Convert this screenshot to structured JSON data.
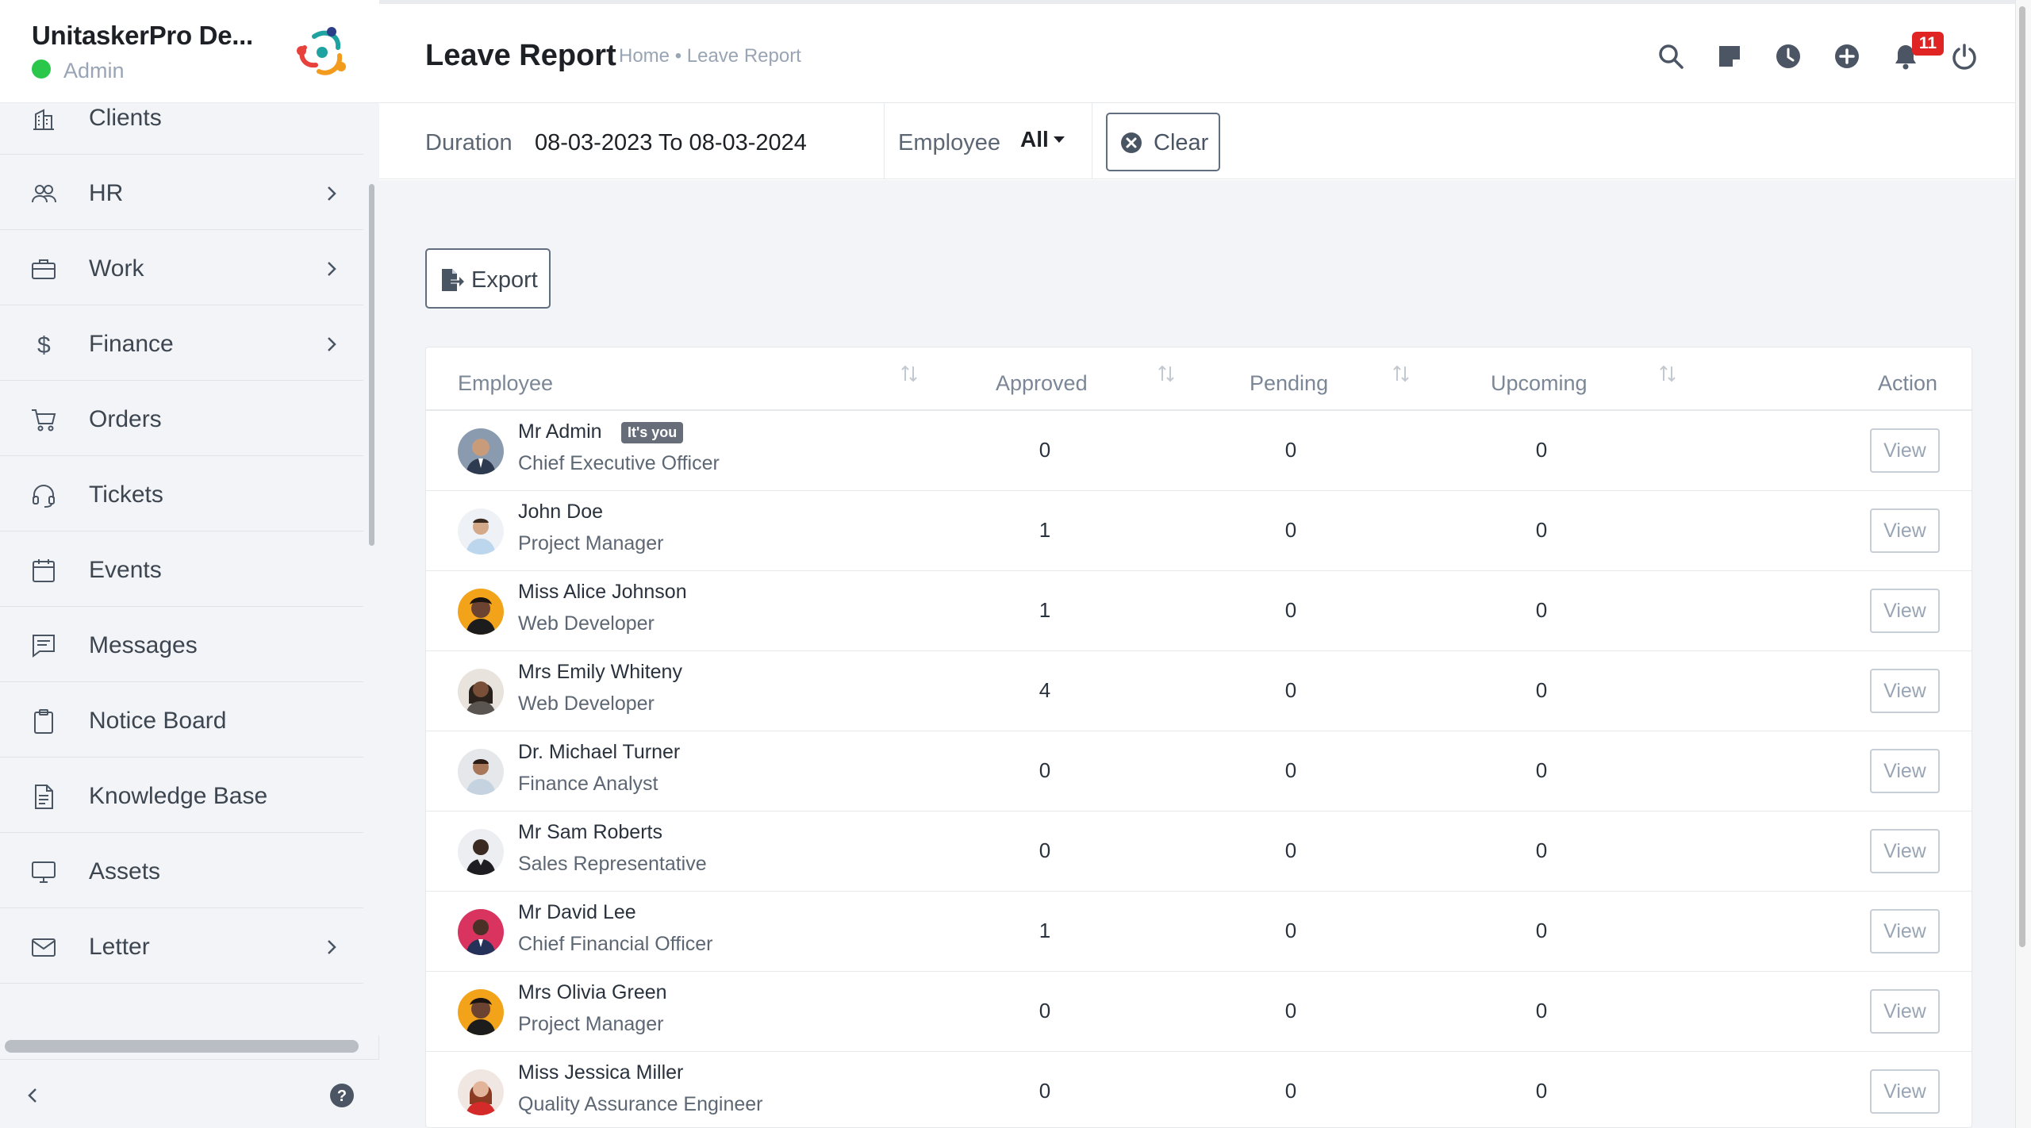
{
  "sidebar": {
    "company_name": "UnitaskerPro De...",
    "user_role": "Admin",
    "online_color": "#2bc74b",
    "items": [
      {
        "label": "Clients",
        "icon": "building-icon",
        "has_chevron": false
      },
      {
        "label": "HR",
        "icon": "users-icon",
        "has_chevron": true
      },
      {
        "label": "Work",
        "icon": "briefcase-icon",
        "has_chevron": true
      },
      {
        "label": "Finance",
        "icon": "dollar-icon",
        "has_chevron": true
      },
      {
        "label": "Orders",
        "icon": "cart-icon",
        "has_chevron": false
      },
      {
        "label": "Tickets",
        "icon": "headset-icon",
        "has_chevron": false
      },
      {
        "label": "Events",
        "icon": "calendar-icon",
        "has_chevron": false
      },
      {
        "label": "Messages",
        "icon": "chat-icon",
        "has_chevron": false
      },
      {
        "label": "Notice Board",
        "icon": "clipboard-icon",
        "has_chevron": false
      },
      {
        "label": "Knowledge Base",
        "icon": "document-icon",
        "has_chevron": false
      },
      {
        "label": "Assets",
        "icon": "monitor-icon",
        "has_chevron": false
      },
      {
        "label": "Letter",
        "icon": "envelope-icon",
        "has_chevron": true
      }
    ]
  },
  "header": {
    "title": "Leave Report",
    "breadcrumb": "Home • Leave Report",
    "icons": [
      "search-icon",
      "sticky-note-icon",
      "clock-icon",
      "plus-circle-icon",
      "bell-icon",
      "power-icon"
    ],
    "notification_count": "11",
    "badge_color": "#e02424"
  },
  "filters": {
    "duration_label": "Duration",
    "duration_value": "08-03-2023 To 08-03-2024",
    "employee_label": "Employee",
    "employee_value": "All",
    "clear_label": "Clear"
  },
  "toolbar": {
    "export_label": "Export"
  },
  "table": {
    "columns": [
      "Employee",
      "Approved",
      "Pending",
      "Upcoming",
      "Action"
    ],
    "you_badge": "It's you",
    "view_label": "View",
    "rows": [
      {
        "name": "Mr Admin",
        "role": "Chief Executive Officer",
        "approved": "0",
        "pending": "0",
        "upcoming": "0",
        "is_you": true
      },
      {
        "name": "John Doe",
        "role": "Project Manager",
        "approved": "1",
        "pending": "0",
        "upcoming": "0",
        "is_you": false
      },
      {
        "name": "Miss Alice Johnson",
        "role": "Web Developer",
        "approved": "1",
        "pending": "0",
        "upcoming": "0",
        "is_you": false
      },
      {
        "name": "Mrs Emily Whiteny",
        "role": "Web Developer",
        "approved": "4",
        "pending": "0",
        "upcoming": "0",
        "is_you": false
      },
      {
        "name": "Dr. Michael Turner",
        "role": "Finance Analyst",
        "approved": "0",
        "pending": "0",
        "upcoming": "0",
        "is_you": false
      },
      {
        "name": "Mr Sam Roberts",
        "role": "Sales Representative",
        "approved": "0",
        "pending": "0",
        "upcoming": "0",
        "is_you": false
      },
      {
        "name": "Mr David Lee",
        "role": "Chief Financial Officer",
        "approved": "1",
        "pending": "0",
        "upcoming": "0",
        "is_you": false
      },
      {
        "name": "Mrs Olivia Green",
        "role": "Project Manager",
        "approved": "0",
        "pending": "0",
        "upcoming": "0",
        "is_you": false
      },
      {
        "name": "Miss Jessica Miller",
        "role": "Quality Assurance Engineer",
        "approved": "0",
        "pending": "0",
        "upcoming": "0",
        "is_you": false
      }
    ]
  }
}
